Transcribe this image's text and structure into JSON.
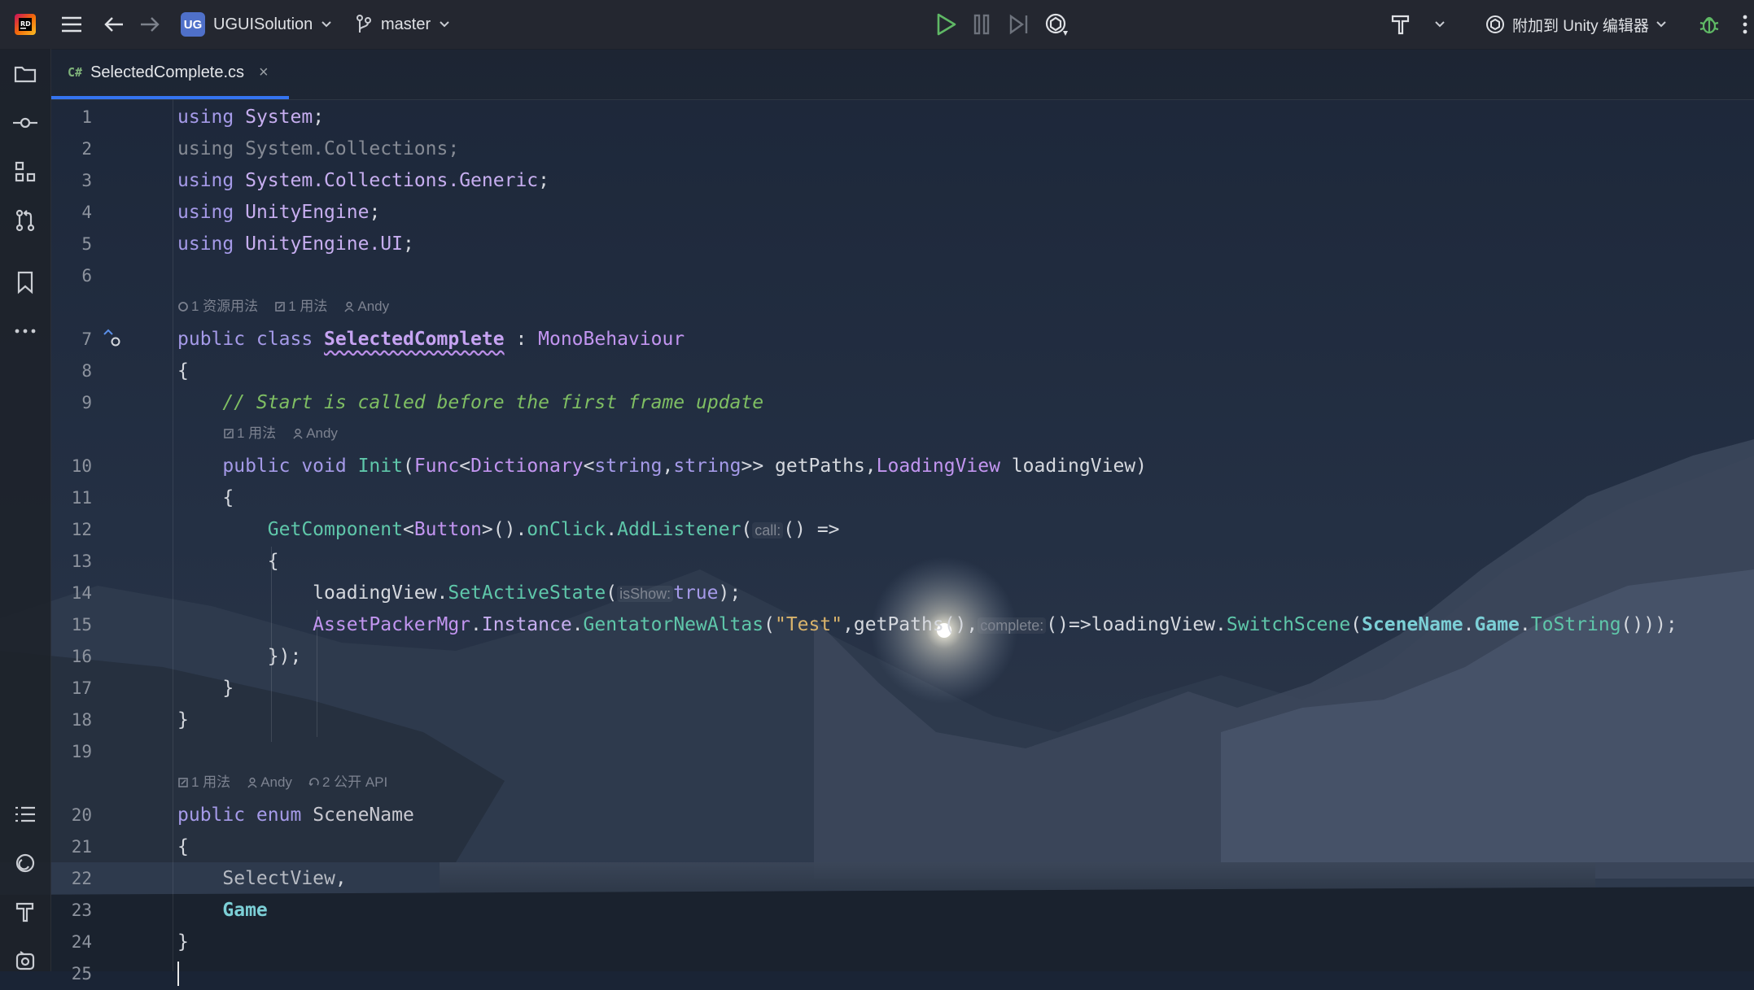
{
  "app": {
    "project_badge": "UG",
    "project_name": "UGUISolution",
    "branch": "master",
    "attach_label": "附加到 Unity 编辑器"
  },
  "tab": {
    "lang": "C#",
    "filename": "SelectedComplete.cs",
    "close": "×"
  },
  "hints": {
    "h1": [
      "1 资源用法",
      "1 用法",
      "Andy"
    ],
    "h2": [
      "1 用法",
      "Andy"
    ],
    "h3": [
      "1 用法",
      "Andy",
      "2 公开 API"
    ]
  },
  "inlays": {
    "call": "call:",
    "isShow": "isShow:",
    "complete": "complete:"
  },
  "line_numbers": [
    "1",
    "2",
    "3",
    "4",
    "5",
    "6",
    "7",
    "8",
    "9",
    "10",
    "11",
    "12",
    "13",
    "14",
    "15",
    "16",
    "17",
    "18",
    "19",
    "20",
    "21",
    "22",
    "23",
    "24",
    "25"
  ],
  "code": {
    "l1": [
      "using",
      " ",
      "System",
      ";"
    ],
    "l2": [
      "using System.Collections;"
    ],
    "l3": [
      "using",
      " ",
      "System.Collections.Generic",
      ";"
    ],
    "l4": [
      "using",
      " ",
      "UnityEngine",
      ";"
    ],
    "l5": [
      "using",
      " ",
      "UnityEngine.UI",
      ";"
    ],
    "l7": [
      "public class",
      " ",
      "SelectedComplete",
      " : ",
      "MonoBehaviour"
    ],
    "l8": [
      "{"
    ],
    "l9": [
      "    ",
      "// Start is called before the first frame update"
    ],
    "l10": [
      "    ",
      "public void",
      " ",
      "Init",
      "(",
      "Func",
      "<",
      "Dictionary",
      "<",
      "string",
      ",",
      "string",
      ">> getPaths,",
      "LoadingView",
      " loadingView)"
    ],
    "l11": [
      "    {"
    ],
    "l12": [
      "        ",
      "GetComponent",
      "<",
      "Button",
      ">().",
      "onClick",
      ".",
      "AddListener",
      "(",
      "() =>"
    ],
    "l13": [
      "        {"
    ],
    "l14": [
      "            loadingView.",
      "SetActiveState",
      "(",
      "true",
      ");"
    ],
    "l15": [
      "            ",
      "AssetPackerMgr",
      ".",
      "Instance",
      ".",
      "GentatorNewAltas",
      "(",
      "\"Test\"",
      ",getPaths(),",
      "()=>loadingView.",
      "SwitchScene",
      "(",
      "SceneName",
      ".",
      "Game",
      ".",
      "ToString",
      "()));"
    ],
    "l16": [
      "        });"
    ],
    "l17": [
      "    }"
    ],
    "l18": [
      "}"
    ],
    "l20": [
      "public enum",
      " ",
      "SceneName"
    ],
    "l21": [
      "{"
    ],
    "l22": [
      "    ",
      "SelectView",
      ","
    ],
    "l23": [
      "    ",
      "Game"
    ],
    "l24": [
      "}"
    ]
  },
  "colors": {
    "accent": "#3574f0",
    "keyword": "#a59ae8",
    "function": "#5fc7aa",
    "comment": "#7fbf63",
    "string": "#d9b36b",
    "run_green": "#5fb865"
  }
}
